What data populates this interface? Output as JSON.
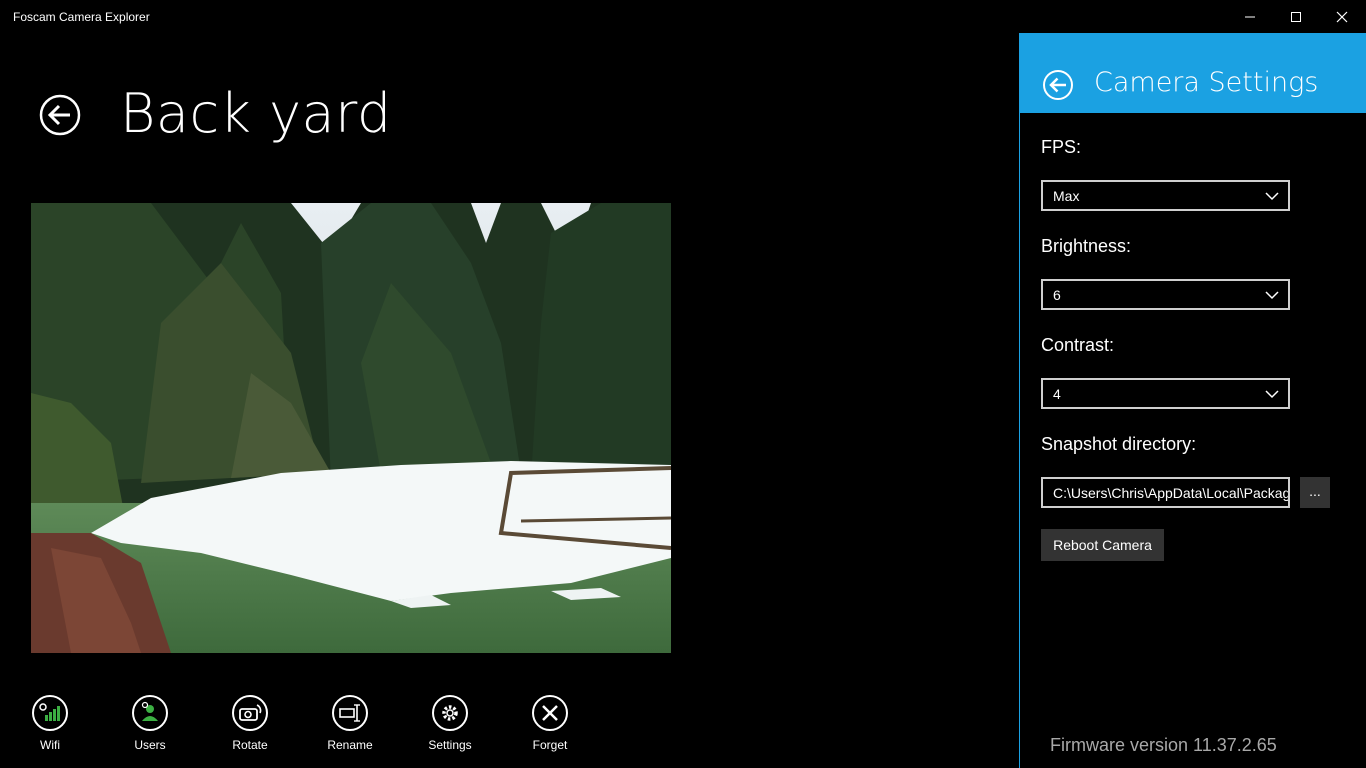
{
  "window": {
    "title": "Foscam Camera Explorer",
    "minimize_icon": "minimize-icon",
    "maximize_icon": "maximize-icon",
    "close_icon": "close-icon"
  },
  "header": {
    "title": "Back yard",
    "back_icon": "back-arrow-icon"
  },
  "appbar": {
    "items": [
      {
        "label": "Wifi",
        "icon": "wifi-signal-icon"
      },
      {
        "label": "Users",
        "icon": "users-icon"
      },
      {
        "label": "Rotate",
        "icon": "rotate-camera-icon"
      },
      {
        "label": "Rename",
        "icon": "rename-icon"
      },
      {
        "label": "Settings",
        "icon": "gear-icon"
      },
      {
        "label": "Forget",
        "icon": "forget-icon"
      }
    ]
  },
  "settings": {
    "title": "Camera Settings",
    "fps": {
      "label": "FPS:",
      "value": "Max"
    },
    "brightness": {
      "label": "Brightness:",
      "value": "6"
    },
    "contrast": {
      "label": "Contrast:",
      "value": "4"
    },
    "snapshot": {
      "label": "Snapshot directory:",
      "value": "C:\\Users\\Chris\\AppData\\Local\\Packages"
    },
    "browse_label": "...",
    "reboot_label": "Reboot Camera",
    "firmware": "Firmware version 11.37.2.65"
  },
  "colors": {
    "accent": "#1ba1e2",
    "background": "#000000",
    "button_bg": "#333333",
    "firmware_text": "#a8a8a8"
  }
}
